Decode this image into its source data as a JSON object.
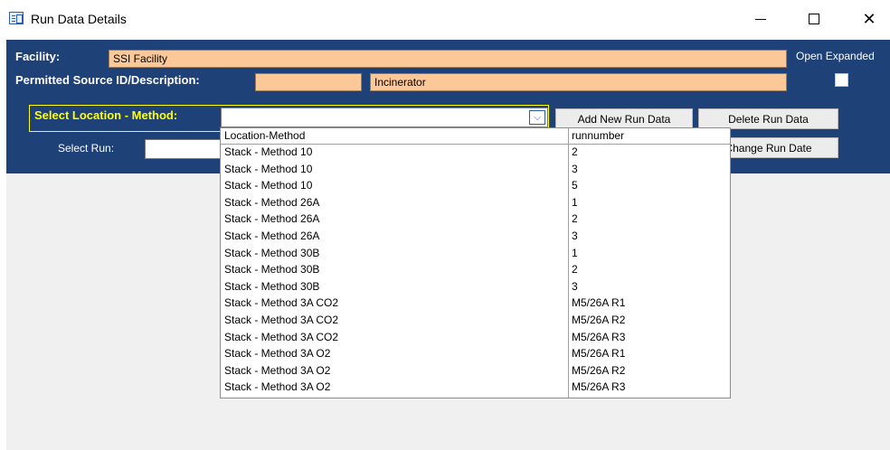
{
  "window": {
    "title": "Run Data Details",
    "minimize_icon": "minimize-icon",
    "maximize_icon": "maximize-icon",
    "close_glyph": "✕"
  },
  "header": {
    "facility_label": "Facility:",
    "facility_value": "SSI Facility",
    "permitted_label": "Permitted Source ID/Description:",
    "permitted_id_value": "",
    "description_value": "Incinerator",
    "open_expanded_label": "Open Expanded",
    "open_expanded_checked": false
  },
  "location": {
    "label": "Select Location - Method:",
    "value": "",
    "arrow_glyph": "⌵"
  },
  "buttons": {
    "add_new_run": "Add New Run Data",
    "delete_run": "Delete Run Data",
    "change_run_date": "Change Run Date"
  },
  "run": {
    "label": "Select Run:",
    "value": ""
  },
  "dropdown": {
    "columns": [
      "Location-Method",
      "runnumber"
    ],
    "rows": [
      [
        "Stack - Method 10",
        "2"
      ],
      [
        "Stack - Method 10",
        "3"
      ],
      [
        "Stack - Method 10",
        "5"
      ],
      [
        "Stack - Method 26A",
        "1"
      ],
      [
        "Stack - Method 26A",
        "2"
      ],
      [
        "Stack - Method 26A",
        "3"
      ],
      [
        "Stack - Method 30B",
        "1"
      ],
      [
        "Stack - Method 30B",
        "2"
      ],
      [
        "Stack - Method 30B",
        "3"
      ],
      [
        "Stack - Method 3A CO2",
        "M5/26A R1"
      ],
      [
        "Stack - Method 3A CO2",
        "M5/26A R2"
      ],
      [
        "Stack - Method 3A CO2",
        "M5/26A R3"
      ],
      [
        "Stack - Method 3A O2",
        "M5/26A R1"
      ],
      [
        "Stack - Method 3A O2",
        "M5/26A R2"
      ],
      [
        "Stack - Method 3A O2",
        "M5/26A R3"
      ]
    ]
  },
  "colors": {
    "header_bg": "#1e4178",
    "field_bg": "#fcc898",
    "highlight": "#ffff00"
  }
}
